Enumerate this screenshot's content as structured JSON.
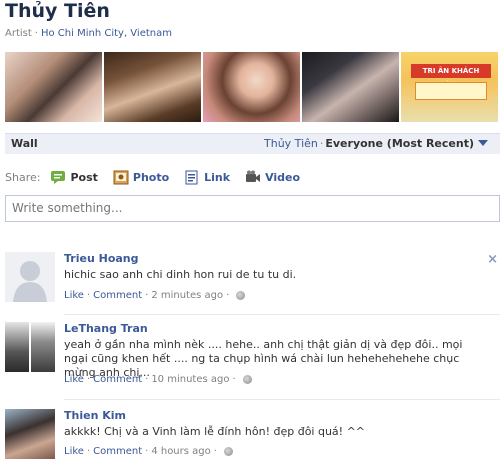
{
  "profile": {
    "name": "Thủy Tiên",
    "category": "Artist",
    "separator": "·",
    "location": "Ho Chi Minh City, Vietnam"
  },
  "photo_strip": {
    "banner_text": "TRI ÂN KHÁCH HÀNG"
  },
  "wall": {
    "title": "Wall",
    "owner_filter": "Thủy Tiên",
    "separator": "·",
    "audience_filter": "Everyone (Most Recent)"
  },
  "share": {
    "label": "Share:",
    "items": [
      {
        "label": "Post",
        "icon": "post-icon"
      },
      {
        "label": "Photo",
        "icon": "photo-icon"
      },
      {
        "label": "Link",
        "icon": "link-icon"
      },
      {
        "label": "Video",
        "icon": "video-icon"
      }
    ],
    "placeholder": "Write something..."
  },
  "posts": [
    {
      "author": "Trieu Hoang",
      "text": "hichic sao anh chi dinh hon rui de tu tu di.",
      "like": "Like",
      "comment": "Comment",
      "time": "2 minutes ago",
      "close": "×"
    },
    {
      "author": "LeThang Tran",
      "text": "yeah ở gần nha mình nèk .... hehe.. anh chị thật giản dị và đẹp đôi.. mọi ngại cũng khen hết .... ng ta chụp hình wá chài lun hehehehehehe chục mừng anh chị...",
      "like": "Like",
      "comment": "Comment",
      "time": "10 minutes ago"
    },
    {
      "author": "Thien Kim",
      "text": "akkkk! Chị và a Vinh làm lễ đính hôn! đẹp đôi quá! ^^",
      "like": "Like",
      "comment": "Comment",
      "time": "4 hours ago"
    }
  ],
  "meta_separator": "·"
}
